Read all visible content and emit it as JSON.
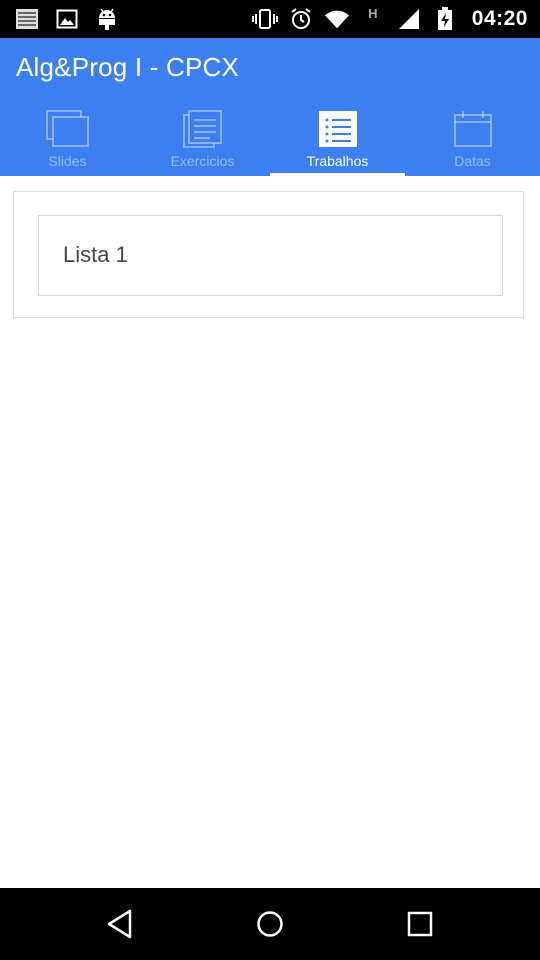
{
  "status_bar": {
    "time": "04:20",
    "network_type": "H",
    "left_icons": [
      "notes-icon",
      "image-icon",
      "android-icon"
    ],
    "right_icons": [
      "vibrate-icon",
      "alarm-icon",
      "wifi-icon",
      "signal-icon",
      "battery-icon"
    ]
  },
  "app_bar": {
    "title": "Alg&Prog I - CPCX",
    "color": "#3b7ff1"
  },
  "tabs": [
    {
      "label": "Slides",
      "icon": "slides-icon",
      "active": false
    },
    {
      "label": "Exercicios",
      "icon": "exercises-icon",
      "active": false
    },
    {
      "label": "Trabalhos",
      "icon": "list-icon",
      "active": true
    },
    {
      "label": "Datas",
      "icon": "calendar-icon",
      "active": false
    }
  ],
  "content": {
    "items": [
      {
        "label": "Lista 1"
      }
    ]
  },
  "nav_bar": {
    "buttons": [
      "back-icon",
      "home-icon",
      "recents-icon"
    ]
  }
}
